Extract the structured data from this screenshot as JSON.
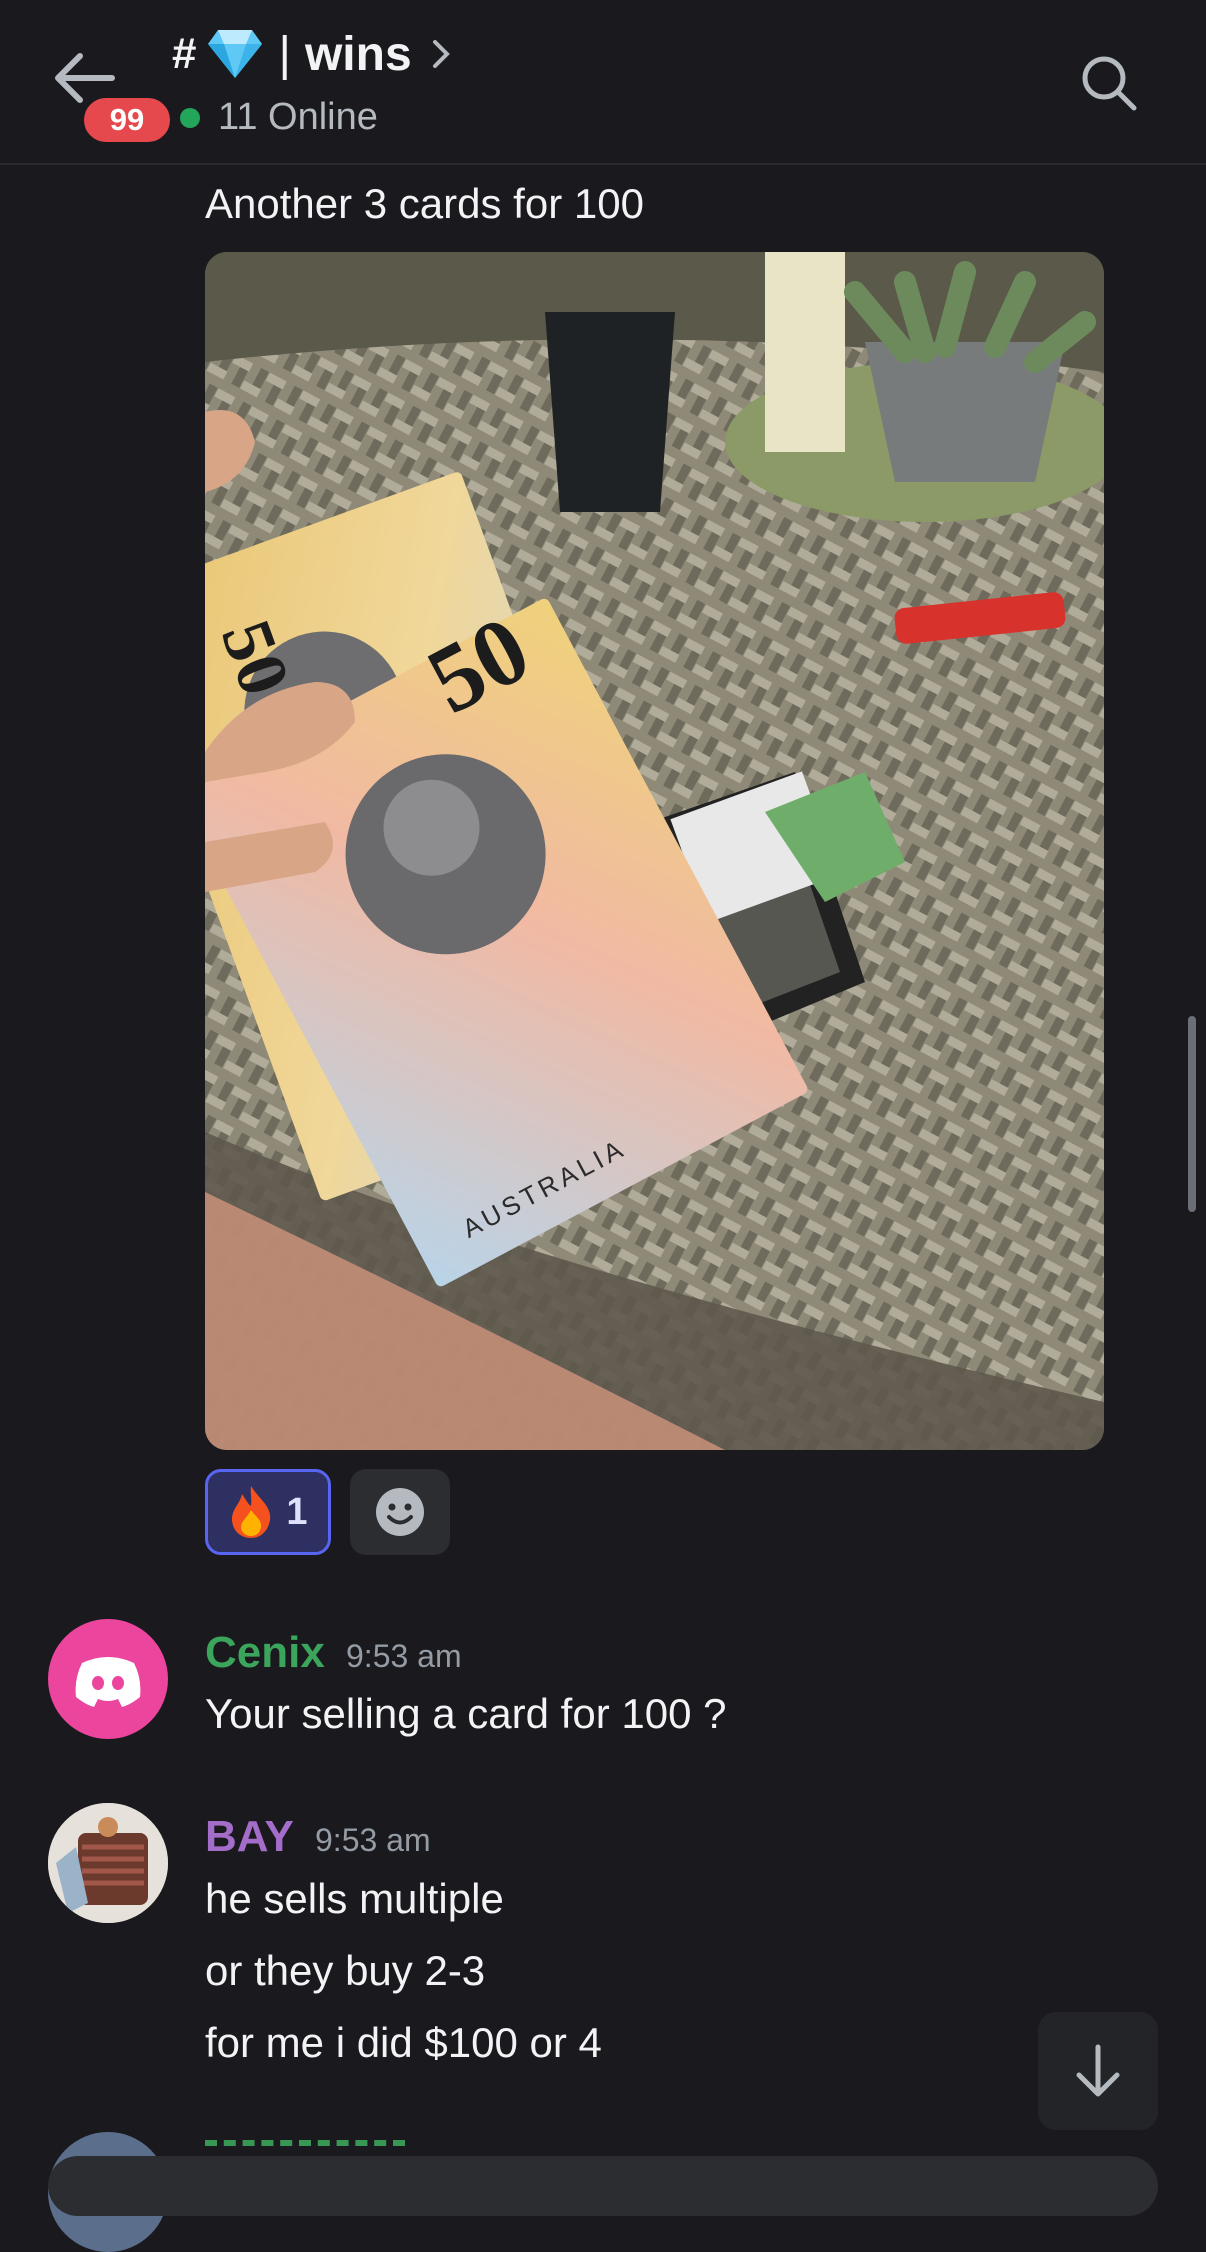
{
  "header": {
    "unread_count": "99",
    "channel_prefix": "#",
    "channel_separator": "|",
    "channel_name": "wins",
    "online_text": "11 Online"
  },
  "messages": [
    {
      "text": "Another 3 cards for 100"
    },
    {
      "author": "Cenix",
      "author_color": "#3ba55c",
      "time": "9:53 am",
      "lines": [
        "Your selling a card for 100 ?"
      ]
    },
    {
      "author": "BAY",
      "author_color": "#a36dc9",
      "time": "9:53 am",
      "lines": [
        "he sells multiple",
        "or they buy 2-3",
        "for me i did $100 or 4"
      ]
    }
  ],
  "attachment": {
    "banknote_value": "50",
    "banknote_country": "AUSTRALIA"
  },
  "reaction": {
    "emoji": "fire-icon",
    "count": "1"
  },
  "colors": {
    "background": "#1a1a1e",
    "accent": "#5865f2",
    "online": "#23a55a",
    "badge": "#e5484d"
  }
}
